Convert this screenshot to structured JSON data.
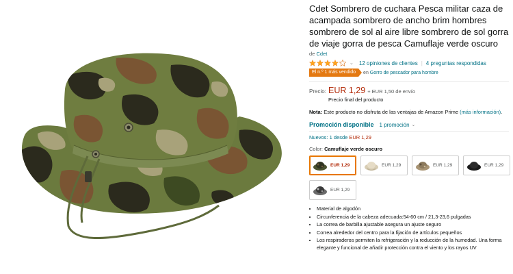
{
  "product": {
    "title": "Cdet Sombrero de cuchara Pesca militar caza de acampada sombrero de ancho brim hombres sombrero de sol al aire libre sombrero de sol gorra de viaje gorra de pesca Camuflaje verde oscuro",
    "brand_prefix": "de",
    "brand": "Cdet",
    "rating_stars": 4,
    "reviews": "12 opiniones de clientes",
    "separator": "|",
    "questions": "4 preguntas respondidas",
    "best_seller_badge": "El n.º 1 más vendido",
    "best_seller_prefix": "en",
    "best_seller_category": "Gorro de pescador para hombre"
  },
  "pricing": {
    "label": "Precio:",
    "price": "EUR 1,29",
    "shipping": "+ EUR 1,50 de envío",
    "final_note": "Precio final del producto"
  },
  "note": {
    "label": "Nota:",
    "text": "Este producto no disfruta de las ventajas de Amazon Prime",
    "link": "(más información)",
    "end": "."
  },
  "promo": {
    "title": "Promoción disponible",
    "count": "1 promoción"
  },
  "new_offers": {
    "text": "Nuevos: 1 desde",
    "price": "EUR 1,29"
  },
  "color": {
    "label": "Color:",
    "selected": "Camuflaje verde oscuro",
    "swatches": [
      {
        "price": "EUR 1,29",
        "selected": true
      },
      {
        "price": "EUR 1,29",
        "selected": false
      },
      {
        "price": "EUR 1,29",
        "selected": false
      },
      {
        "price": "EUR 1,29",
        "selected": false
      },
      {
        "price": "EUR 1,29",
        "selected": false
      }
    ]
  },
  "bullets": [
    "Material de algodón",
    "Circunferencia de la cabeza adecuada:54-60 cm / 21,3-23,6 pulgadas",
    "La correa de barbilla ajustable asegura un ajuste seguro",
    "Correa alrededor del centro para la fijación de artículos pequeños",
    "Los respiraderos permiten la refrigeración y la reducción de la humedad. Una forma elegante y funcional de añadir protección contra el viento y los rayos UV"
  ],
  "colors": {
    "link": "#007185",
    "price": "#b12704",
    "badge": "#e47911",
    "star": "#ffa41c"
  }
}
